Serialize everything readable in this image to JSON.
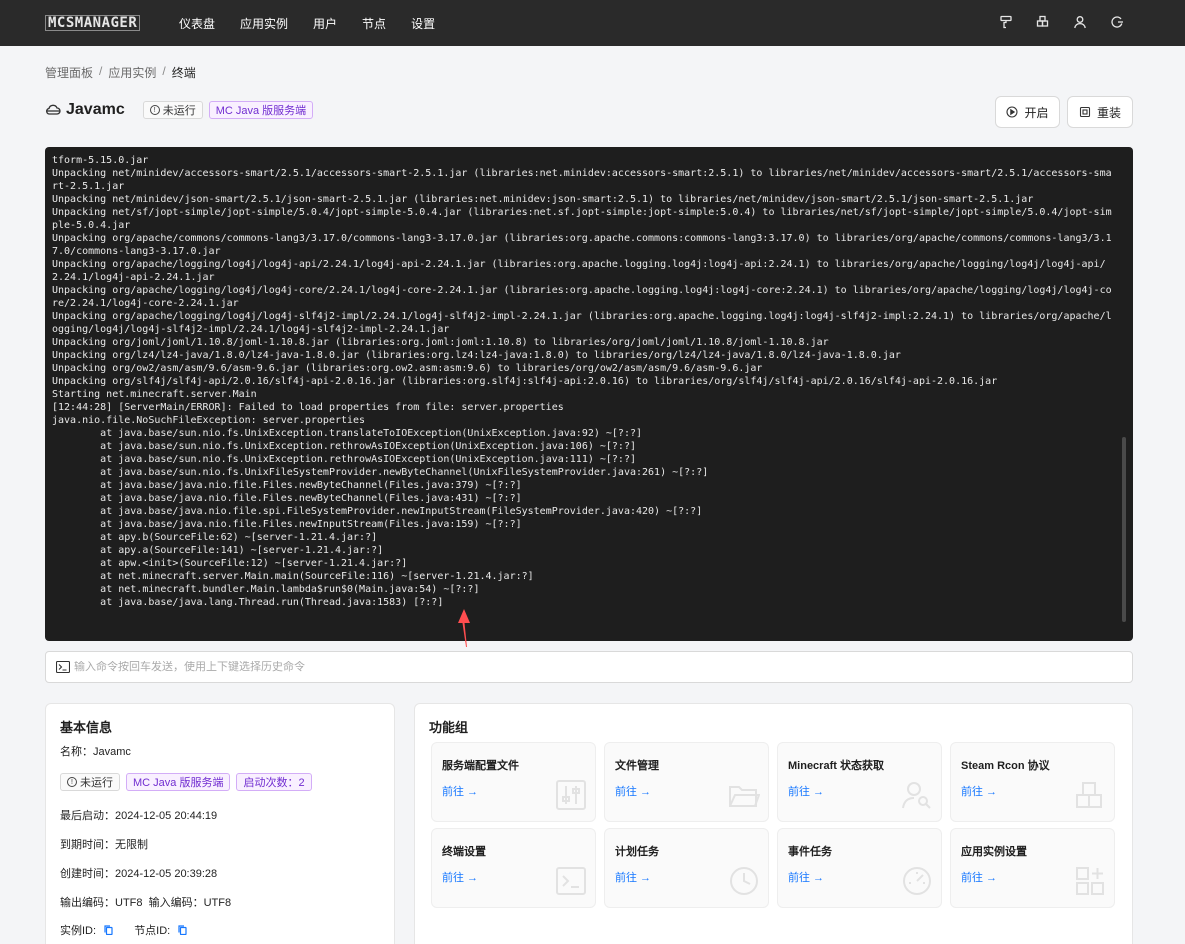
{
  "nav": {
    "logo": "MCSMANAGER",
    "items": [
      "仪表盘",
      "应用实例",
      "用户",
      "节点",
      "设置"
    ]
  },
  "breadcrumb": [
    "管理面板",
    "应用实例",
    "终端"
  ],
  "instance": {
    "name": "Javamc",
    "status": "未运行",
    "type": "MC Java 版服务端",
    "start_button": "开启",
    "reinstall_button": "重装"
  },
  "terminal": {
    "lines": [
      "tform-5.15.0.jar",
      "Unpacking net/minidev/accessors-smart/2.5.1/accessors-smart-2.5.1.jar (libraries:net.minidev:accessors-smart:2.5.1) to libraries/net/minidev/accessors-smart/2.5.1/accessors-smart-2.5.1.jar",
      "Unpacking net/minidev/json-smart/2.5.1/json-smart-2.5.1.jar (libraries:net.minidev:json-smart:2.5.1) to libraries/net/minidev/json-smart/2.5.1/json-smart-2.5.1.jar",
      "Unpacking net/sf/jopt-simple/jopt-simple/5.0.4/jopt-simple-5.0.4.jar (libraries:net.sf.jopt-simple:jopt-simple:5.0.4) to libraries/net/sf/jopt-simple/jopt-simple/5.0.4/jopt-simple-5.0.4.jar",
      "Unpacking org/apache/commons/commons-lang3/3.17.0/commons-lang3-3.17.0.jar (libraries:org.apache.commons:commons-lang3:3.17.0) to libraries/org/apache/commons/commons-lang3/3.17.0/commons-lang3-3.17.0.jar",
      "Unpacking org/apache/logging/log4j/log4j-api/2.24.1/log4j-api-2.24.1.jar (libraries:org.apache.logging.log4j:log4j-api:2.24.1) to libraries/org/apache/logging/log4j/log4j-api/2.24.1/log4j-api-2.24.1.jar",
      "Unpacking org/apache/logging/log4j/log4j-core/2.24.1/log4j-core-2.24.1.jar (libraries:org.apache.logging.log4j:log4j-core:2.24.1) to libraries/org/apache/logging/log4j/log4j-core/2.24.1/log4j-core-2.24.1.jar",
      "Unpacking org/apache/logging/log4j/log4j-slf4j2-impl/2.24.1/log4j-slf4j2-impl-2.24.1.jar (libraries:org.apache.logging.log4j:log4j-slf4j2-impl:2.24.1) to libraries/org/apache/logging/log4j/log4j-slf4j2-impl/2.24.1/log4j-slf4j2-impl-2.24.1.jar",
      "Unpacking org/joml/joml/1.10.8/joml-1.10.8.jar (libraries:org.joml:joml:1.10.8) to libraries/org/joml/joml/1.10.8/joml-1.10.8.jar",
      "Unpacking org/lz4/lz4-java/1.8.0/lz4-java-1.8.0.jar (libraries:org.lz4:lz4-java:1.8.0) to libraries/org/lz4/lz4-java/1.8.0/lz4-java-1.8.0.jar",
      "Unpacking org/ow2/asm/asm/9.6/asm-9.6.jar (libraries:org.ow2.asm:asm:9.6) to libraries/org/ow2/asm/asm/9.6/asm-9.6.jar",
      "Unpacking org/slf4j/slf4j-api/2.0.16/slf4j-api-2.0.16.jar (libraries:org.slf4j:slf4j-api:2.0.16) to libraries/org/slf4j/slf4j-api/2.0.16/slf4j-api-2.0.16.jar",
      "Starting net.minecraft.server.Main",
      "[12:44:28] [ServerMain/ERROR]: Failed to load properties from file: server.properties",
      "java.nio.file.NoSuchFileException: server.properties",
      "        at java.base/sun.nio.fs.UnixException.translateToIOException(UnixException.java:92) ~[?:?]",
      "        at java.base/sun.nio.fs.UnixException.rethrowAsIOException(UnixException.java:106) ~[?:?]",
      "        at java.base/sun.nio.fs.UnixException.rethrowAsIOException(UnixException.java:111) ~[?:?]",
      "        at java.base/sun.nio.fs.UnixFileSystemProvider.newByteChannel(UnixFileSystemProvider.java:261) ~[?:?]",
      "        at java.base/java.nio.file.Files.newByteChannel(Files.java:379) ~[?:?]",
      "        at java.base/java.nio.file.Files.newByteChannel(Files.java:431) ~[?:?]",
      "        at java.base/java.nio.file.spi.FileSystemProvider.newInputStream(FileSystemProvider.java:420) ~[?:?]",
      "        at java.base/java.nio.file.Files.newInputStream(Files.java:159) ~[?:?]",
      "        at apy.b(SourceFile:62) ~[server-1.21.4.jar:?]",
      "        at apy.a(SourceFile:141) ~[server-1.21.4.jar:?]",
      "        at apw.<init>(SourceFile:12) ~[server-1.21.4.jar:?]",
      "        at net.minecraft.server.Main.main(SourceFile:116) ~[server-1.21.4.jar:?]",
      "        at net.minecraft.bundler.Main.lambda$run$0(Main.java:54) ~[?:?]",
      "        at java.base/java.lang.Thread.run(Thread.java:1583) [?:?]"
    ]
  },
  "command": {
    "placeholder": "输入命令按回车发送，使用上下键选择历史命令"
  },
  "basic_info": {
    "title": "基本信息",
    "name_line": "名称：Javamc",
    "status": "未运行",
    "type": "MC Java 版服务端",
    "start_count": "启动次数：2",
    "last_start": "最后启动：2024-12-05 20:44:19",
    "expire": "到期时间：无限制",
    "created": "创建时间：2024-12-05 20:39:28",
    "encoding": "输出编码：UTF8  输入编码：UTF8",
    "instance_id_label": "实例ID:",
    "node_id_label": "节点ID:"
  },
  "functions": {
    "title": "功能组",
    "link_label": "前往 →",
    "items": [
      {
        "title": "服务端配置文件",
        "icon": "sliders-icon"
      },
      {
        "title": "文件管理",
        "icon": "folder-icon"
      },
      {
        "title": "Minecraft 状态获取",
        "icon": "user-search-icon"
      },
      {
        "title": "Steam Rcon 协议",
        "icon": "blocks-icon"
      },
      {
        "title": "终端设置",
        "icon": "terminal-icon"
      },
      {
        "title": "计划任务",
        "icon": "clock-icon"
      },
      {
        "title": "事件任务",
        "icon": "dashboard-icon"
      },
      {
        "title": "应用实例设置",
        "icon": "apps-icon"
      }
    ]
  },
  "colors": {
    "nav_bg": "#2a2a2a",
    "terminal_bg": "#1e1e1e",
    "link": "#1677ff",
    "purple_badge": "#722ed1",
    "arrow": "#ff4d4f"
  }
}
